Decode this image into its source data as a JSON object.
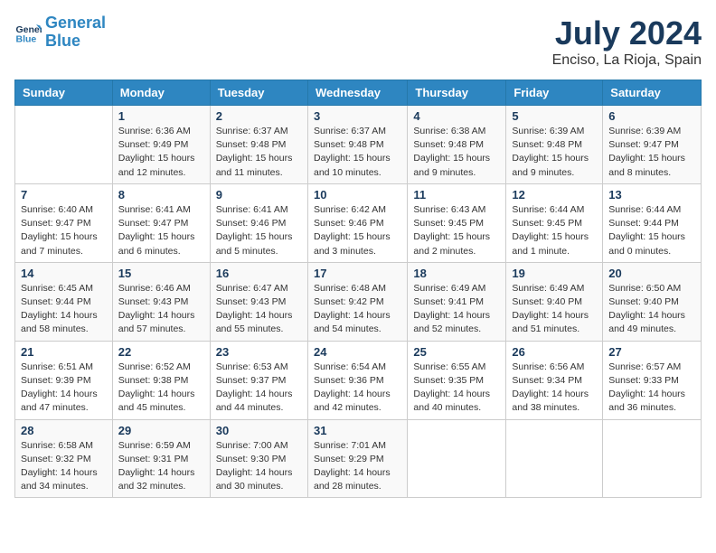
{
  "logo": {
    "line1": "General",
    "line2": "Blue"
  },
  "title": "July 2024",
  "subtitle": "Enciso, La Rioja, Spain",
  "days_header": [
    "Sunday",
    "Monday",
    "Tuesday",
    "Wednesday",
    "Thursday",
    "Friday",
    "Saturday"
  ],
  "weeks": [
    [
      {
        "day": "",
        "detail": ""
      },
      {
        "day": "1",
        "detail": "Sunrise: 6:36 AM\nSunset: 9:49 PM\nDaylight: 15 hours\nand 12 minutes."
      },
      {
        "day": "2",
        "detail": "Sunrise: 6:37 AM\nSunset: 9:48 PM\nDaylight: 15 hours\nand 11 minutes."
      },
      {
        "day": "3",
        "detail": "Sunrise: 6:37 AM\nSunset: 9:48 PM\nDaylight: 15 hours\nand 10 minutes."
      },
      {
        "day": "4",
        "detail": "Sunrise: 6:38 AM\nSunset: 9:48 PM\nDaylight: 15 hours\nand 9 minutes."
      },
      {
        "day": "5",
        "detail": "Sunrise: 6:39 AM\nSunset: 9:48 PM\nDaylight: 15 hours\nand 9 minutes."
      },
      {
        "day": "6",
        "detail": "Sunrise: 6:39 AM\nSunset: 9:47 PM\nDaylight: 15 hours\nand 8 minutes."
      }
    ],
    [
      {
        "day": "7",
        "detail": "Sunrise: 6:40 AM\nSunset: 9:47 PM\nDaylight: 15 hours\nand 7 minutes."
      },
      {
        "day": "8",
        "detail": "Sunrise: 6:41 AM\nSunset: 9:47 PM\nDaylight: 15 hours\nand 6 minutes."
      },
      {
        "day": "9",
        "detail": "Sunrise: 6:41 AM\nSunset: 9:46 PM\nDaylight: 15 hours\nand 5 minutes."
      },
      {
        "day": "10",
        "detail": "Sunrise: 6:42 AM\nSunset: 9:46 PM\nDaylight: 15 hours\nand 3 minutes."
      },
      {
        "day": "11",
        "detail": "Sunrise: 6:43 AM\nSunset: 9:45 PM\nDaylight: 15 hours\nand 2 minutes."
      },
      {
        "day": "12",
        "detail": "Sunrise: 6:44 AM\nSunset: 9:45 PM\nDaylight: 15 hours\nand 1 minute."
      },
      {
        "day": "13",
        "detail": "Sunrise: 6:44 AM\nSunset: 9:44 PM\nDaylight: 15 hours\nand 0 minutes."
      }
    ],
    [
      {
        "day": "14",
        "detail": "Sunrise: 6:45 AM\nSunset: 9:44 PM\nDaylight: 14 hours\nand 58 minutes."
      },
      {
        "day": "15",
        "detail": "Sunrise: 6:46 AM\nSunset: 9:43 PM\nDaylight: 14 hours\nand 57 minutes."
      },
      {
        "day": "16",
        "detail": "Sunrise: 6:47 AM\nSunset: 9:43 PM\nDaylight: 14 hours\nand 55 minutes."
      },
      {
        "day": "17",
        "detail": "Sunrise: 6:48 AM\nSunset: 9:42 PM\nDaylight: 14 hours\nand 54 minutes."
      },
      {
        "day": "18",
        "detail": "Sunrise: 6:49 AM\nSunset: 9:41 PM\nDaylight: 14 hours\nand 52 minutes."
      },
      {
        "day": "19",
        "detail": "Sunrise: 6:49 AM\nSunset: 9:40 PM\nDaylight: 14 hours\nand 51 minutes."
      },
      {
        "day": "20",
        "detail": "Sunrise: 6:50 AM\nSunset: 9:40 PM\nDaylight: 14 hours\nand 49 minutes."
      }
    ],
    [
      {
        "day": "21",
        "detail": "Sunrise: 6:51 AM\nSunset: 9:39 PM\nDaylight: 14 hours\nand 47 minutes."
      },
      {
        "day": "22",
        "detail": "Sunrise: 6:52 AM\nSunset: 9:38 PM\nDaylight: 14 hours\nand 45 minutes."
      },
      {
        "day": "23",
        "detail": "Sunrise: 6:53 AM\nSunset: 9:37 PM\nDaylight: 14 hours\nand 44 minutes."
      },
      {
        "day": "24",
        "detail": "Sunrise: 6:54 AM\nSunset: 9:36 PM\nDaylight: 14 hours\nand 42 minutes."
      },
      {
        "day": "25",
        "detail": "Sunrise: 6:55 AM\nSunset: 9:35 PM\nDaylight: 14 hours\nand 40 minutes."
      },
      {
        "day": "26",
        "detail": "Sunrise: 6:56 AM\nSunset: 9:34 PM\nDaylight: 14 hours\nand 38 minutes."
      },
      {
        "day": "27",
        "detail": "Sunrise: 6:57 AM\nSunset: 9:33 PM\nDaylight: 14 hours\nand 36 minutes."
      }
    ],
    [
      {
        "day": "28",
        "detail": "Sunrise: 6:58 AM\nSunset: 9:32 PM\nDaylight: 14 hours\nand 34 minutes."
      },
      {
        "day": "29",
        "detail": "Sunrise: 6:59 AM\nSunset: 9:31 PM\nDaylight: 14 hours\nand 32 minutes."
      },
      {
        "day": "30",
        "detail": "Sunrise: 7:00 AM\nSunset: 9:30 PM\nDaylight: 14 hours\nand 30 minutes."
      },
      {
        "day": "31",
        "detail": "Sunrise: 7:01 AM\nSunset: 9:29 PM\nDaylight: 14 hours\nand 28 minutes."
      },
      {
        "day": "",
        "detail": ""
      },
      {
        "day": "",
        "detail": ""
      },
      {
        "day": "",
        "detail": ""
      }
    ]
  ]
}
